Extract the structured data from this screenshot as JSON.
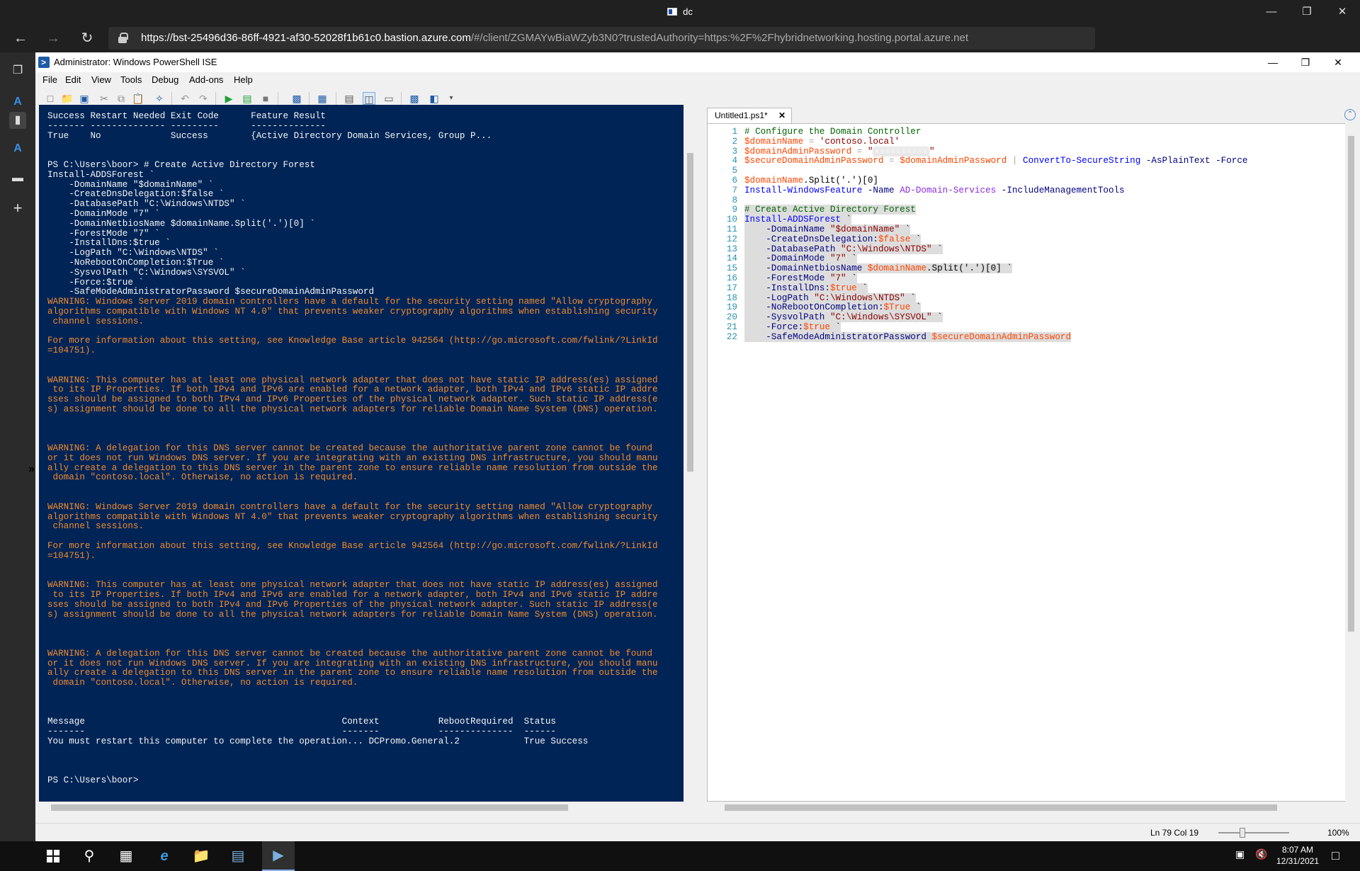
{
  "browser": {
    "window_title": "dc",
    "url_host": "https://bst-25496d36-86ff-4921-af30-52028f1b61c0.bastion.azure.com",
    "url_rest": "/#/client/ZGMAYwBiaWZyb3N0?trustedAuthority=https:%2F%2Fhybridnetworking.hosting.portal.azure.net"
  },
  "ise": {
    "title": "Administrator: Windows PowerShell ISE",
    "menu": [
      "File",
      "Edit",
      "View",
      "Tools",
      "Debug",
      "Add-ons",
      "Help"
    ],
    "tab_label": "Untitled1.ps1*",
    "status": {
      "position": "Ln 79  Col 19",
      "zoom": "100%"
    }
  },
  "console": {
    "lines": [
      {
        "t": "Success Restart Needed Exit Code      Feature Result",
        "w": false
      },
      {
        "t": "------- -------------- ---------      --------------",
        "w": false
      },
      {
        "t": "True    No             Success        {Active Directory Domain Services, Group P...",
        "w": false
      },
      {
        "t": "",
        "w": false
      },
      {
        "t": "",
        "w": false
      },
      {
        "t": "PS C:\\Users\\boor> # Create Active Directory Forest",
        "w": false
      },
      {
        "t": "Install-ADDSForest `",
        "w": false
      },
      {
        "t": "    -DomainName \"$domainName\" `",
        "w": false
      },
      {
        "t": "    -CreateDnsDelegation:$false `",
        "w": false
      },
      {
        "t": "    -DatabasePath \"C:\\Windows\\NTDS\" `",
        "w": false
      },
      {
        "t": "    -DomainMode \"7\" `",
        "w": false
      },
      {
        "t": "    -DomainNetbiosName $domainName.Split('.')[0] `",
        "w": false
      },
      {
        "t": "    -ForestMode \"7\" `",
        "w": false
      },
      {
        "t": "    -InstallDns:$true `",
        "w": false
      },
      {
        "t": "    -LogPath \"C:\\Windows\\NTDS\" `",
        "w": false
      },
      {
        "t": "    -NoRebootOnCompletion:$True `",
        "w": false
      },
      {
        "t": "    -SysvolPath \"C:\\Windows\\SYSVOL\" `",
        "w": false
      },
      {
        "t": "    -Force:$true `",
        "w": false
      },
      {
        "t": "    -SafeModeAdministratorPassword $secureDomainAdminPassword",
        "w": false
      },
      {
        "t": "WARNING: Windows Server 2019 domain controllers have a default for the security setting named \"Allow cryptography",
        "w": true
      },
      {
        "t": "algorithms compatible with Windows NT 4.0\" that prevents weaker cryptography algorithms when establishing security",
        "w": true
      },
      {
        "t": " channel sessions.",
        "w": true
      },
      {
        "t": "",
        "w": true
      },
      {
        "t": "For more information about this setting, see Knowledge Base article 942564 (http://go.microsoft.com/fwlink/?LinkId",
        "w": true
      },
      {
        "t": "=104751).",
        "w": true
      },
      {
        "t": "",
        "w": true
      },
      {
        "t": "",
        "w": true
      },
      {
        "t": "WARNING: This computer has at least one physical network adapter that does not have static IP address(es) assigned",
        "w": true
      },
      {
        "t": " to its IP Properties. If both IPv4 and IPv6 are enabled for a network adapter, both IPv4 and IPv6 static IP addre",
        "w": true
      },
      {
        "t": "sses should be assigned to both IPv4 and IPv6 Properties of the physical network adapter. Such static IP address(e",
        "w": true
      },
      {
        "t": "s) assignment should be done to all the physical network adapters for reliable Domain Name System (DNS) operation.",
        "w": true
      },
      {
        "t": "",
        "w": true
      },
      {
        "t": "",
        "w": true
      },
      {
        "t": "",
        "w": true
      },
      {
        "t": "WARNING: A delegation for this DNS server cannot be created because the authoritative parent zone cannot be found",
        "w": true
      },
      {
        "t": "or it does not run Windows DNS server. If you are integrating with an existing DNS infrastructure, you should manu",
        "w": true
      },
      {
        "t": "ally create a delegation to this DNS server in the parent zone to ensure reliable name resolution from outside the",
        "w": true
      },
      {
        "t": " domain \"contoso.local\". Otherwise, no action is required.",
        "w": true
      },
      {
        "t": "",
        "w": true
      },
      {
        "t": "",
        "w": true
      },
      {
        "t": "WARNING: Windows Server 2019 domain controllers have a default for the security setting named \"Allow cryptography",
        "w": true
      },
      {
        "t": "algorithms compatible with Windows NT 4.0\" that prevents weaker cryptography algorithms when establishing security",
        "w": true
      },
      {
        "t": " channel sessions.",
        "w": true
      },
      {
        "t": "",
        "w": true
      },
      {
        "t": "For more information about this setting, see Knowledge Base article 942564 (http://go.microsoft.com/fwlink/?LinkId",
        "w": true
      },
      {
        "t": "=104751).",
        "w": true
      },
      {
        "t": "",
        "w": true
      },
      {
        "t": "",
        "w": true
      },
      {
        "t": "WARNING: This computer has at least one physical network adapter that does not have static IP address(es) assigned",
        "w": true
      },
      {
        "t": " to its IP Properties. If both IPv4 and IPv6 are enabled for a network adapter, both IPv4 and IPv6 static IP addre",
        "w": true
      },
      {
        "t": "sses should be assigned to both IPv4 and IPv6 Properties of the physical network adapter. Such static IP address(e",
        "w": true
      },
      {
        "t": "s) assignment should be done to all the physical network adapters for reliable Domain Name System (DNS) operation.",
        "w": true
      },
      {
        "t": "",
        "w": true
      },
      {
        "t": "",
        "w": true
      },
      {
        "t": "",
        "w": true
      },
      {
        "t": "WARNING: A delegation for this DNS server cannot be created because the authoritative parent zone cannot be found",
        "w": true
      },
      {
        "t": "or it does not run Windows DNS server. If you are integrating with an existing DNS infrastructure, you should manu",
        "w": true
      },
      {
        "t": "ally create a delegation to this DNS server in the parent zone to ensure reliable name resolution from outside the",
        "w": true
      },
      {
        "t": " domain \"contoso.local\". Otherwise, no action is required.",
        "w": true
      },
      {
        "t": "",
        "w": false
      },
      {
        "t": "",
        "w": false
      },
      {
        "t": "",
        "w": false
      },
      {
        "t": "Message                                                Context           RebootRequired  Status",
        "w": false
      },
      {
        "t": "-------                                                -------           --------------  ------",
        "w": false
      },
      {
        "t": "You must restart this computer to complete the operation... DCPromo.General.2            True Success",
        "w": false
      },
      {
        "t": "",
        "w": false
      },
      {
        "t": "",
        "w": false
      },
      {
        "t": "",
        "w": false
      },
      {
        "t": "PS C:\\Users\\boor>",
        "w": false
      }
    ]
  },
  "editor": {
    "line_numbers": [
      "1",
      "2",
      "3",
      "4",
      "5",
      "6",
      "7",
      "8",
      "9",
      "10",
      "11",
      "12",
      "13",
      "14",
      "15",
      "16",
      "17",
      "18",
      "19",
      "20",
      "21",
      "22"
    ],
    "code": {
      "l1": "# Configure the Domain Controller",
      "l2_var": "$domainName",
      "l2_str": "'contoso.local'",
      "l3_var": "$domainAdminPassword",
      "l3_q": "\"",
      "l3_hidden": "xxxxxxxxxx",
      "l4_var": "$secureDomainAdminPassword",
      "l4_var2": "$domainAdminPassword",
      "l4_cmd": "ConvertTo-SecureString",
      "l4_p1": "-AsPlainText",
      "l4_p2": "-Force",
      "l6_var": "$domainName",
      "l6_rest": ".Split('.')[0]",
      "l7_cmd": "Install-WindowsFeature",
      "l7_p1": "-Name",
      "l7_arg": "AD-Domain-Services",
      "l7_p2": "-IncludeManagementTools",
      "l9": "# Create Active Directory Forest",
      "l10": "Install-ADDSForest",
      "l11_p": "-DomainName",
      "l11_s": "\"$domainName\"",
      "l12_p": "-CreateDnsDelegation:",
      "l12_v": "$false",
      "l13_p": "-DatabasePath",
      "l13_s": "\"C:\\Windows\\NTDS\"",
      "l14_p": "-DomainMode",
      "l14_s": "\"7\"",
      "l15_p": "-DomainNetbiosName",
      "l15_v": "$domainName",
      "l15_rest": ".Split('.')[0]",
      "l16_p": "-ForestMode",
      "l16_s": "\"7\"",
      "l17_p": "-InstallDns:",
      "l17_v": "$true",
      "l18_p": "-LogPath",
      "l18_s": "\"C:\\Windows\\NTDS\"",
      "l19_p": "-NoRebootOnCompletion:",
      "l19_v": "$True",
      "l20_p": "-SysvolPath",
      "l20_s": "\"C:\\Windows\\SYSVOL\"",
      "l21_p": "-Force:",
      "l21_v": "$true",
      "l22_p": "-SafeModeAdministratorPassword",
      "l22_v": "$secureDomainAdminPassword"
    }
  },
  "taskbar": {
    "time": "8:07 AM",
    "date": "12/31/2021"
  },
  "colors": {
    "console_bg": "#012456",
    "warning": "#f28b2e",
    "accent": "#1e5ba8"
  }
}
